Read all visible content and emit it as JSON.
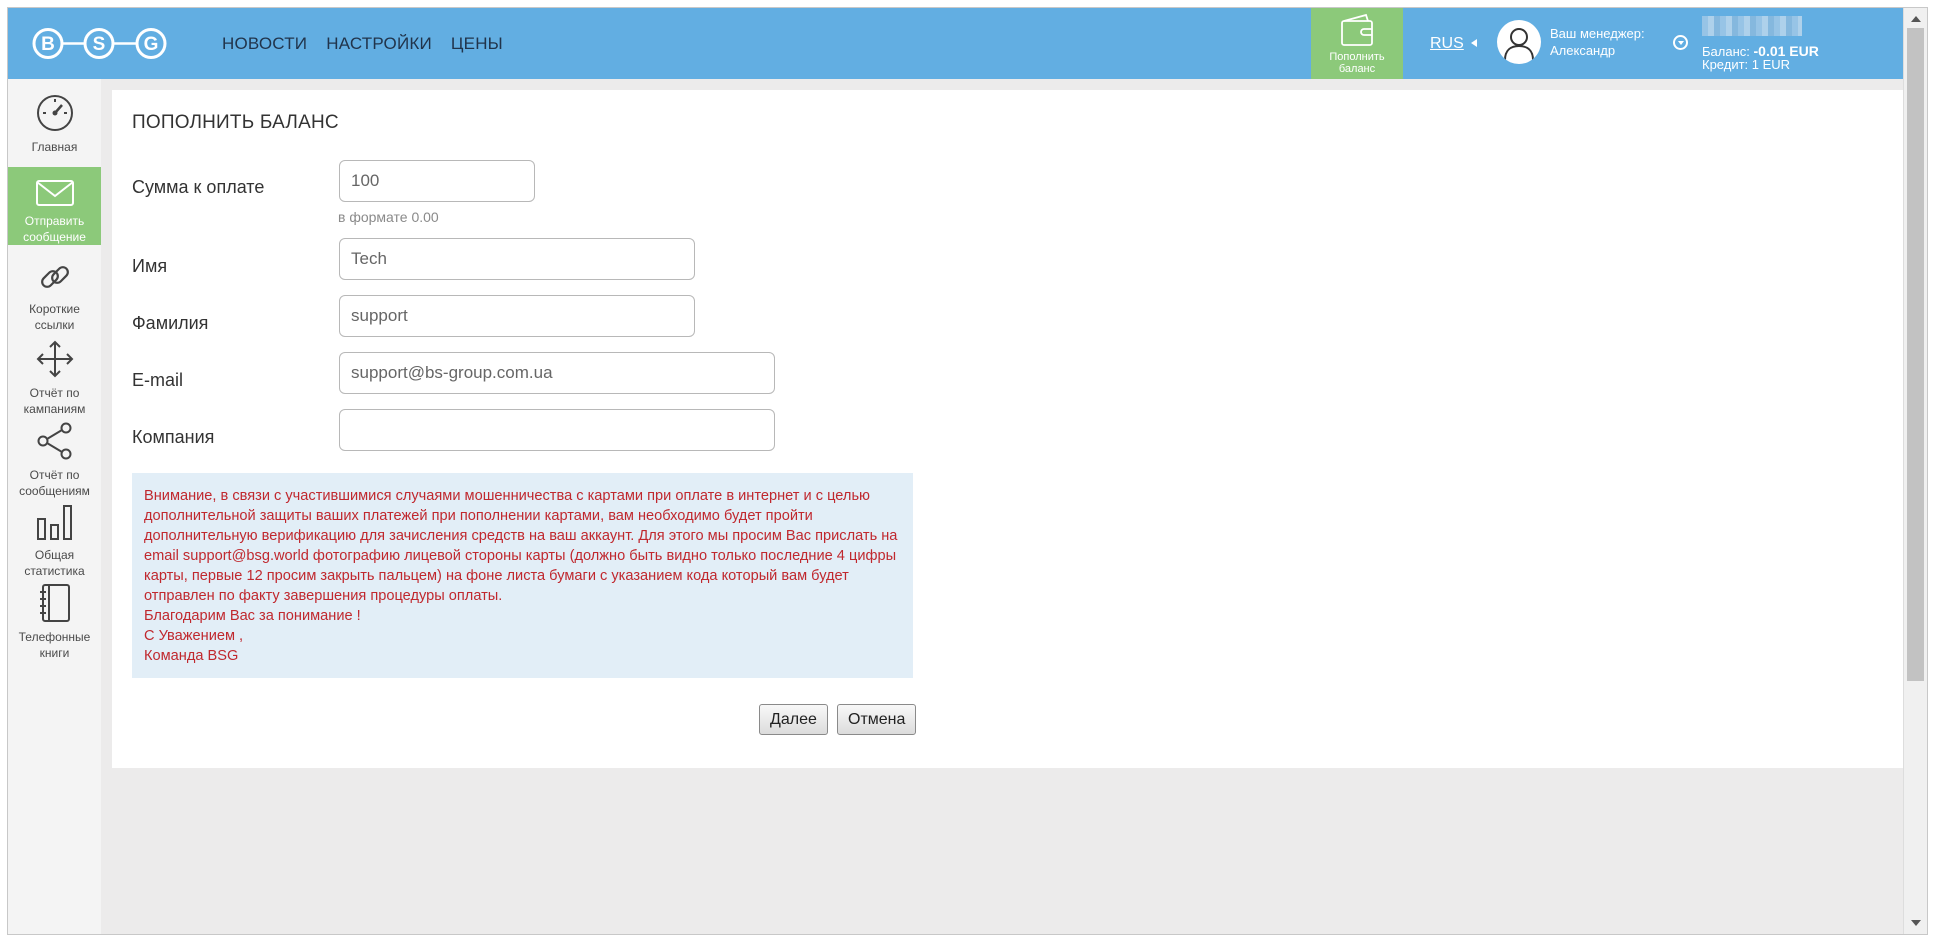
{
  "header": {
    "logo_letters": [
      "B",
      "S",
      "G"
    ],
    "nav": [
      "НОВОСТИ",
      "НАСТРОЙКИ",
      "ЦЕНЫ"
    ],
    "topup_button": {
      "line1": "Пополнить",
      "line2": "баланс"
    },
    "language": "RUS",
    "manager": {
      "label": "Ваш менеджер:",
      "name": "Александр"
    },
    "balance_line": "Баланс:",
    "balance_value": "-0.01 EUR",
    "credit_line": "Кредит: 1 EUR"
  },
  "sidebar": {
    "items": [
      {
        "label": "Главная",
        "icon": "dashboard-icon"
      },
      {
        "label": "Отправить сообщение",
        "icon": "envelope-icon",
        "active": true
      },
      {
        "label": "Короткие ссылки",
        "icon": "link-icon"
      },
      {
        "label": "Отчёт по кампаниям",
        "icon": "move-arrows-icon"
      },
      {
        "label": "Отчёт по сообщениям",
        "icon": "share-icon"
      },
      {
        "label": "Общая статистика",
        "icon": "bar-chart-icon"
      },
      {
        "label": "Телефонные книги",
        "icon": "notebook-icon"
      }
    ]
  },
  "form": {
    "title": "ПОПОЛНИТЬ БАЛАНС",
    "amount": {
      "label": "Сумма к оплате",
      "value": "100",
      "hint": "в формате 0.00"
    },
    "first_name": {
      "label": "Имя",
      "value": "Tech"
    },
    "last_name": {
      "label": "Фамилия",
      "value": "support"
    },
    "email": {
      "label": "E-mail",
      "value": "support@bs-group.com.ua"
    },
    "company": {
      "label": "Компания",
      "value": ""
    },
    "notice": {
      "paragraph": "Внимание, в связи с участившимися случаями мошенничества с картами при оплате в интернет и с целью дополнительной защиты ваших платежей при пополнении картами, вам необходимо будет пройти дополнительную верификацию для зачисления средств на ваш аккаунт. Для этого мы просим Вас прислать на email support@bsg.world фотографию лицевой стороны карты (должно быть видно только последние 4 цифры карты, первые 12 просим закрыть пальцем) на фоне листа бумаги с указанием кода который вам будет отправлен по факту завершения процедуры оплаты.",
      "thanks": "Благодарим Вас за понимание !",
      "regards": "С Уважением ,",
      "team": "Команда BSG"
    },
    "next_button": "Далее",
    "cancel_button": "Отмена"
  },
  "colors": {
    "header_blue": "#62aee2",
    "accent_green": "#8cc97a",
    "notice_bg": "#e2eef7",
    "notice_text": "#c0282e"
  }
}
